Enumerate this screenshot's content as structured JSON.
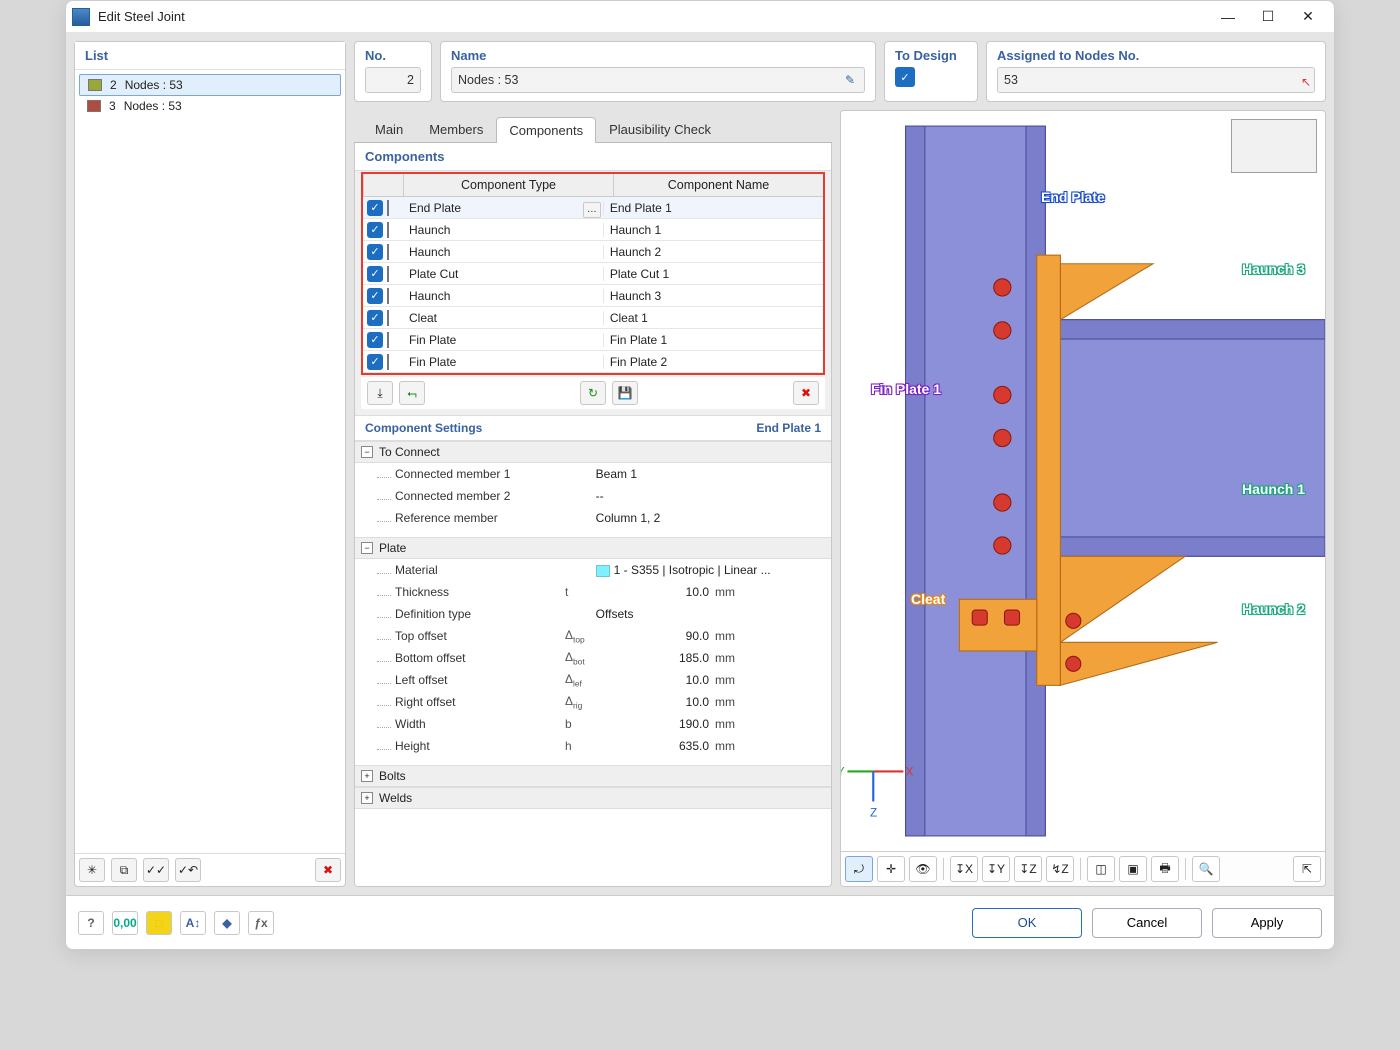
{
  "window": {
    "title": "Edit Steel Joint"
  },
  "list_panel": {
    "header": "List",
    "items": [
      {
        "idx": "2",
        "label": "Nodes : 53",
        "color": "#9aa83a",
        "selected": true
      },
      {
        "idx": "3",
        "label": "Nodes : 53",
        "color": "#b24b3f",
        "selected": false
      }
    ]
  },
  "header_fields": {
    "no": {
      "label": "No.",
      "value": "2"
    },
    "name": {
      "label": "Name",
      "value": "Nodes : 53"
    },
    "to_design": {
      "label": "To Design",
      "checked": true
    },
    "assigned": {
      "label": "Assigned to Nodes No.",
      "value": "53"
    }
  },
  "tabs": [
    "Main",
    "Members",
    "Components",
    "Plausibility Check"
  ],
  "active_tab": "Components",
  "components_table": {
    "header": "Components",
    "columns": [
      "Component Type",
      "Component Name"
    ],
    "rows": [
      {
        "color": "#e06b27",
        "type": "End Plate",
        "name": "End Plate 1",
        "selected": true
      },
      {
        "color": "#f2c6a0",
        "type": "Haunch",
        "name": "Haunch 1"
      },
      {
        "color": "#f2c6a0",
        "type": "Haunch",
        "name": "Haunch 2"
      },
      {
        "color": "#f1c232",
        "type": "Plate Cut",
        "name": "Plate Cut 1"
      },
      {
        "color": "#f2c6a0",
        "type": "Haunch",
        "name": "Haunch 3"
      },
      {
        "color": "#7a7a7a",
        "type": "Cleat",
        "name": "Cleat 1"
      },
      {
        "color": "#1fa27a",
        "type": "Fin Plate",
        "name": "Fin Plate 1"
      },
      {
        "color": "#1fa27a",
        "type": "Fin Plate",
        "name": "Fin Plate 2"
      }
    ]
  },
  "component_settings": {
    "header": "Component Settings",
    "current": "End Plate 1",
    "groups": [
      {
        "name": "To Connect",
        "expanded": true,
        "rows": [
          {
            "name": "Connected member 1",
            "sym": "",
            "val": "Beam 1",
            "unit": "",
            "align": "left"
          },
          {
            "name": "Connected member 2",
            "sym": "",
            "val": "--",
            "unit": "",
            "align": "left"
          },
          {
            "name": "Reference member",
            "sym": "",
            "val": "Column 1, 2",
            "unit": "",
            "align": "left"
          }
        ]
      },
      {
        "name": "Plate",
        "expanded": true,
        "rows": [
          {
            "name": "Material",
            "sym": "",
            "val": "1 - S355 | Isotropic | Linear ...",
            "unit": "",
            "align": "left",
            "swatch": true
          },
          {
            "name": "Thickness",
            "sym": "t",
            "val": "10.0",
            "unit": "mm"
          },
          {
            "name": "Definition type",
            "sym": "",
            "val": "Offsets",
            "unit": "",
            "align": "left"
          },
          {
            "name": "Top offset",
            "sym": "Δ<sub>top</sub>",
            "val": "90.0",
            "unit": "mm"
          },
          {
            "name": "Bottom offset",
            "sym": "Δ<sub>bot</sub>",
            "val": "185.0",
            "unit": "mm"
          },
          {
            "name": "Left offset",
            "sym": "Δ<sub>lef</sub>",
            "val": "10.0",
            "unit": "mm"
          },
          {
            "name": "Right offset",
            "sym": "Δ<sub>rig</sub>",
            "val": "10.0",
            "unit": "mm"
          },
          {
            "name": "Width",
            "sym": "b",
            "val": "190.0",
            "unit": "mm"
          },
          {
            "name": "Height",
            "sym": "h",
            "val": "635.0",
            "unit": "mm"
          }
        ]
      },
      {
        "name": "Bolts",
        "expanded": false,
        "rows": []
      },
      {
        "name": "Welds",
        "expanded": false,
        "rows": []
      }
    ]
  },
  "viewer_labels": {
    "end_plate": "End Plate",
    "haunch3": "Haunch 3",
    "haunch1": "Haunch 1",
    "haunch2": "Haunch 2",
    "finplate1": "Fin Plate 1",
    "cleat": "Cleat"
  },
  "footer": {
    "ok": "OK",
    "cancel": "Cancel",
    "apply": "Apply"
  },
  "status_icons": [
    "?",
    "0,00",
    "□",
    "A↕",
    "◆",
    "ƒx"
  ]
}
